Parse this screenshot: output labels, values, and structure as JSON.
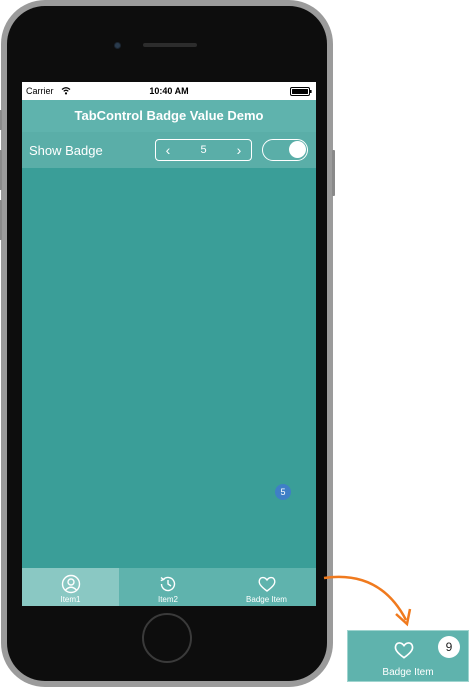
{
  "status_bar": {
    "carrier": "Carrier",
    "time": "10:40 AM"
  },
  "nav_bar": {
    "title": "TabControl Badge Value Demo"
  },
  "toolbar": {
    "label": "Show Badge",
    "stepper": {
      "decrement": "‹",
      "value": "5",
      "increment": "›"
    },
    "toggle_on": true
  },
  "tabs": [
    {
      "label": "Item1",
      "icon": "user-icon",
      "selected": true
    },
    {
      "label": "Item2",
      "icon": "history-icon",
      "selected": false
    },
    {
      "label": "Badge Item",
      "icon": "heart-icon",
      "selected": false,
      "badge": "5"
    }
  ],
  "callout": {
    "label": "Badge Item",
    "badge": "9",
    "icon": "heart-icon"
  },
  "colors": {
    "screen_bg": "#3a9e98",
    "bar_bg": "#5fb3ad",
    "selected_tab_bg": "#8ac8c3",
    "badge_bg": "#3f7fc6",
    "arrow": "#f07a1e"
  }
}
